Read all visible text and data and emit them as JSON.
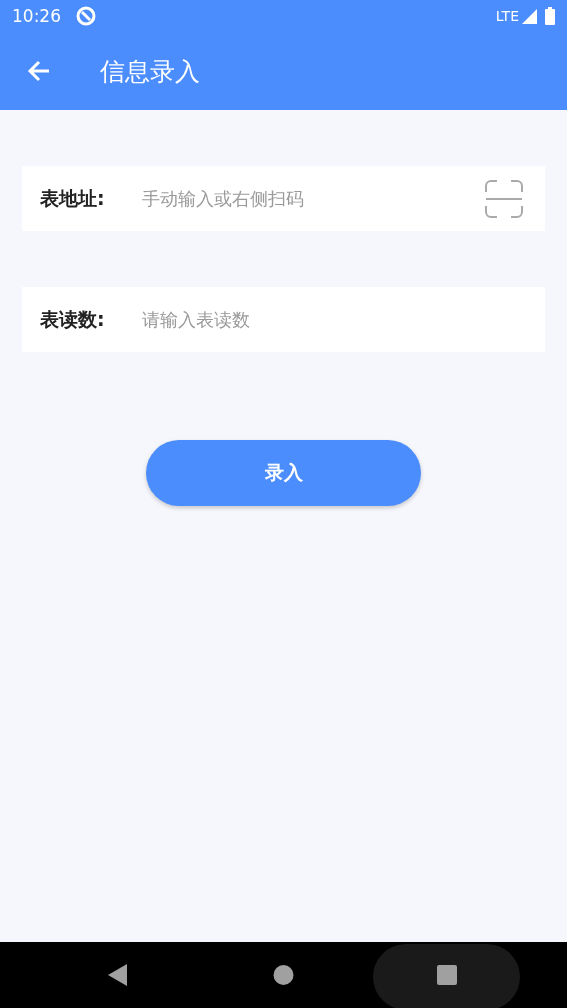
{
  "status_bar": {
    "time": "10:26",
    "network": "LTE"
  },
  "app_bar": {
    "title": "信息录入"
  },
  "fields": [
    {
      "kind": "scan",
      "label": "表地址:",
      "placeholder": "手动输入或右侧扫码"
    },
    {
      "kind": "text",
      "label": "表读数:",
      "placeholder": "请输入表读数"
    }
  ],
  "submit_button": {
    "label": "录入"
  }
}
